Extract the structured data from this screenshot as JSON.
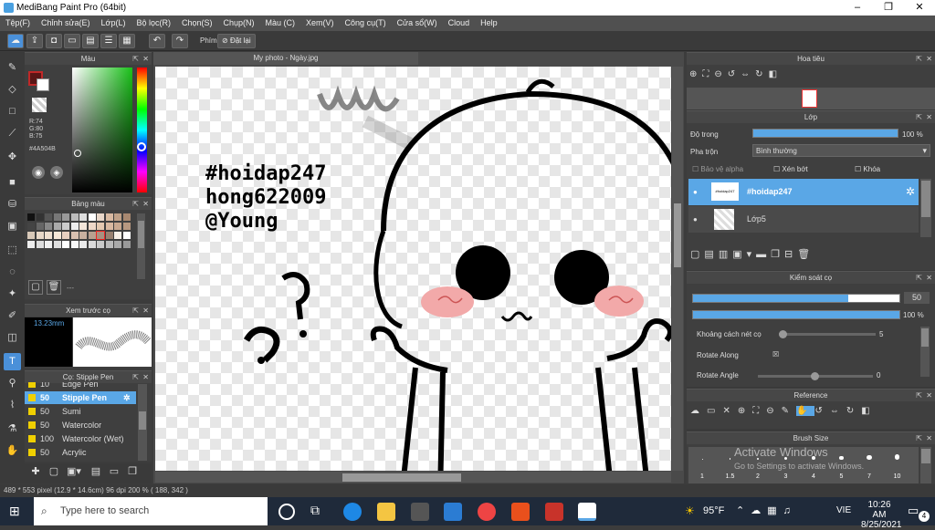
{
  "window": {
    "title": "MediBang Paint Pro (64bit)",
    "minimize": "–",
    "maximize": "❐",
    "close": "✕"
  },
  "menu": [
    "Tệp(F)",
    "Chỉnh sửa(E)",
    "Lớp(L)",
    "Bộ lọc(R)",
    "Chọn(S)",
    "Chụp(N)",
    "Màu (C)",
    "Xem(V)",
    "Công cụ(T)",
    "Cửa sổ(W)",
    "Cloud",
    "Help"
  ],
  "toolbar": {
    "key_label": "Phím",
    "reset_label": "Đặt lại"
  },
  "color_panel": {
    "title": "Màu",
    "r": "R:74",
    "g": "G:80",
    "b": "B:75",
    "hex": "#4A504B",
    "current_color": "#4a504b"
  },
  "palette_panel": {
    "title": "Bảng màu",
    "footer": "---"
  },
  "preview_panel": {
    "title": "Xem trước cọ",
    "size": "13.23mm"
  },
  "brush_panel": {
    "title": "Cọ: Stipple Pen",
    "items": [
      {
        "size": "10",
        "name": "Edge Pen",
        "active": false
      },
      {
        "size": "50",
        "name": "Stipple Pen",
        "active": true
      },
      {
        "size": "50",
        "name": "Sumi",
        "active": false
      },
      {
        "size": "50",
        "name": "Watercolor",
        "active": false
      },
      {
        "size": "100",
        "name": "Watercolor (Wet)",
        "active": false
      },
      {
        "size": "50",
        "name": "Acrylic",
        "active": false
      }
    ]
  },
  "document": {
    "tab": "My photo - Ngày.jpg",
    "text_line1": "#hoidap247",
    "text_line2": "hong622009",
    "text_line3": "@Young"
  },
  "navigator_panel": {
    "title": "Hoa tiêu"
  },
  "layer_panel": {
    "title": "Lớp",
    "opacity_label": "Độ trong",
    "opacity_value": "100 %",
    "blend_label": "Pha trộn",
    "blend_value": "Bình thường",
    "protect_alpha": "Bảo vệ alpha",
    "clip": "Xén bớt",
    "lock": "Khóa",
    "layers": [
      {
        "name": "#hoidap247",
        "active": true,
        "thumb_text": "#hoidap247"
      },
      {
        "name": "Lớp5",
        "active": false,
        "thumb_text": ""
      }
    ]
  },
  "brush_control": {
    "title": "Kiểm soát cọ",
    "size_value": "50",
    "opacity_value": "100 %",
    "spacing_label": "Khoảng cách nét cọ",
    "spacing_value": "5",
    "rotate_along": "Rotate Along",
    "rotate_angle": "Rotate Angle",
    "rotate_angle_value": "0",
    "size_fraction": 0.75,
    "opacity_fraction": 1.0
  },
  "reference_panel": {
    "title": "Reference"
  },
  "brush_size_panel": {
    "title": "Brush Size",
    "sizes": [
      "1",
      "1.5",
      "2",
      "3",
      "4",
      "5",
      "7",
      "10"
    ]
  },
  "watermark": {
    "line1": "Activate Windows",
    "line2": "Go to Settings to activate Windows."
  },
  "status": "489 * 553 pixel   (12.9 * 14.6cm)   96 dpi   200 %   ( 188, 342 )",
  "taskbar": {
    "search_placeholder": "Type here to search",
    "weather": "95°F",
    "lang": "VIE",
    "time": "10:26 AM",
    "date": "8/25/2021",
    "notifications": "4"
  }
}
